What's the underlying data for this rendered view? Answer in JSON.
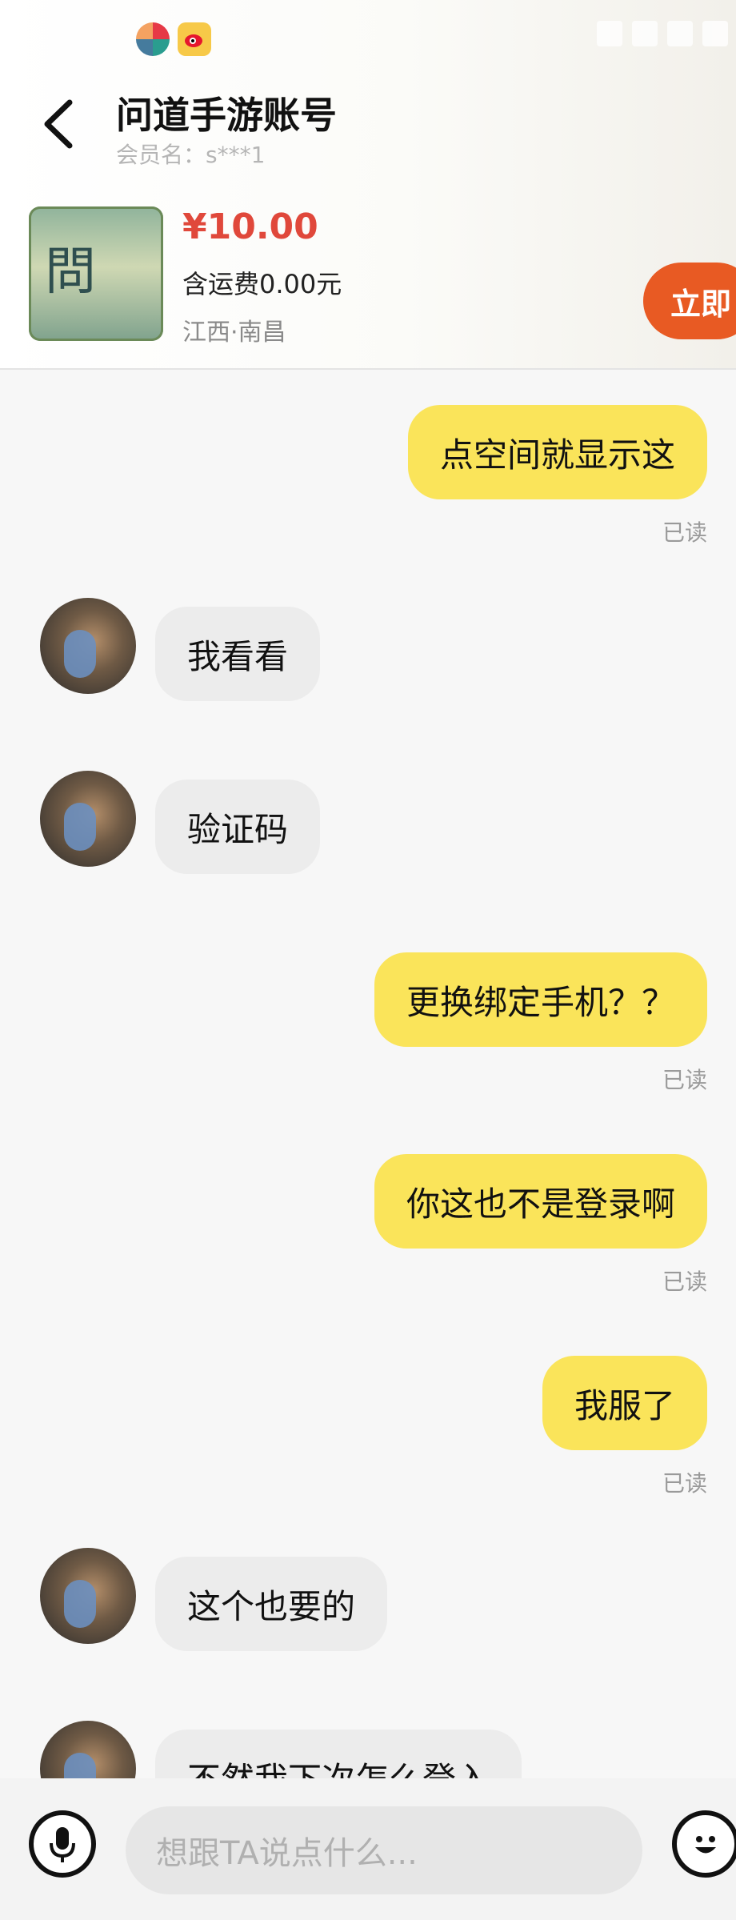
{
  "header": {
    "title": "问道手游账号",
    "subtitle": "会员名：s***1"
  },
  "product": {
    "price": "¥10.00",
    "shipping": "含运费0.00元",
    "location": "江西·南昌",
    "buy_button_label": "立即",
    "thumbnail_glyph": "问道"
  },
  "messages": [
    {
      "side": "me",
      "text": "点空间就显示这",
      "status": "已读"
    },
    {
      "side": "them",
      "text": "我看看"
    },
    {
      "side": "them",
      "text": "验证码"
    },
    {
      "side": "me",
      "text": "更换绑定手机？？",
      "status": "已读"
    },
    {
      "side": "me",
      "text": "你这也不是登录啊",
      "status": "已读"
    },
    {
      "side": "me",
      "text": "我服了",
      "status": "已读"
    },
    {
      "side": "them",
      "text": "这个也要的"
    },
    {
      "side": "them",
      "text": "不然我下次怎么登入"
    }
  ],
  "input": {
    "placeholder": "想跟TA说点什么..."
  },
  "icons": {
    "back": "chevron-left-icon",
    "mic": "microphone-icon",
    "emoji": "smile-icon"
  },
  "colors": {
    "my_bubble": "#fae45a",
    "their_bubble": "#ececec",
    "price": "#e0483b",
    "buy_button": "#e85a23"
  }
}
